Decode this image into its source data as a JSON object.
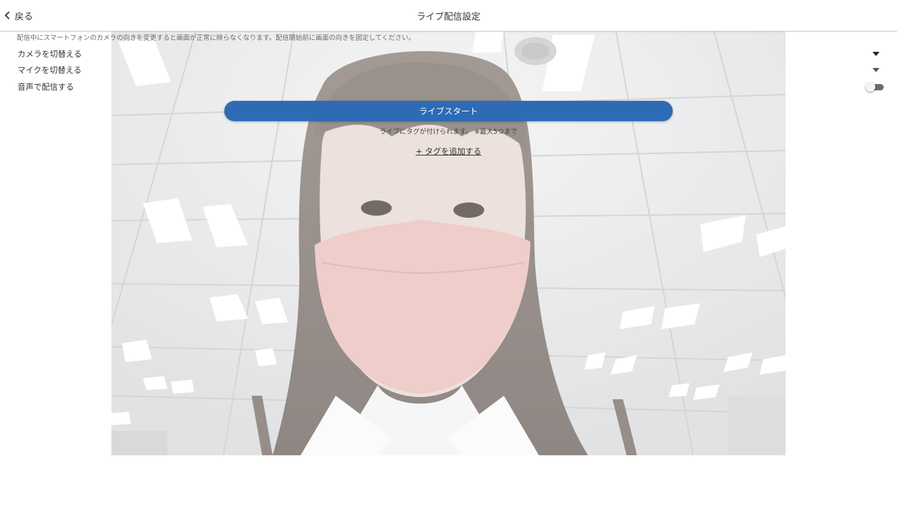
{
  "header": {
    "back_label": "戻る",
    "title": "ライブ配信設定"
  },
  "settings": {
    "warning": "配信中にスマートフォンのカメラの向きを変更すると画面が正常に映らなくなります。配信開始前に画面の向きを固定してください。",
    "camera_label": "カメラを切替える",
    "mic_label": "マイクを切替える",
    "audio_label": "音声で配信する",
    "audio_enabled": false
  },
  "live": {
    "start_label": "ライブスタート",
    "tag_note": "ライブにタグが付けられます。 ※最大5つまで",
    "add_tag_label": "+ タグを追加する"
  },
  "icons": {
    "back": "chevron-left-icon",
    "dropdown": "caret-down-icon"
  },
  "colors": {
    "accent": "#2d6bb5",
    "toggle_track": "#6b6b6b"
  }
}
